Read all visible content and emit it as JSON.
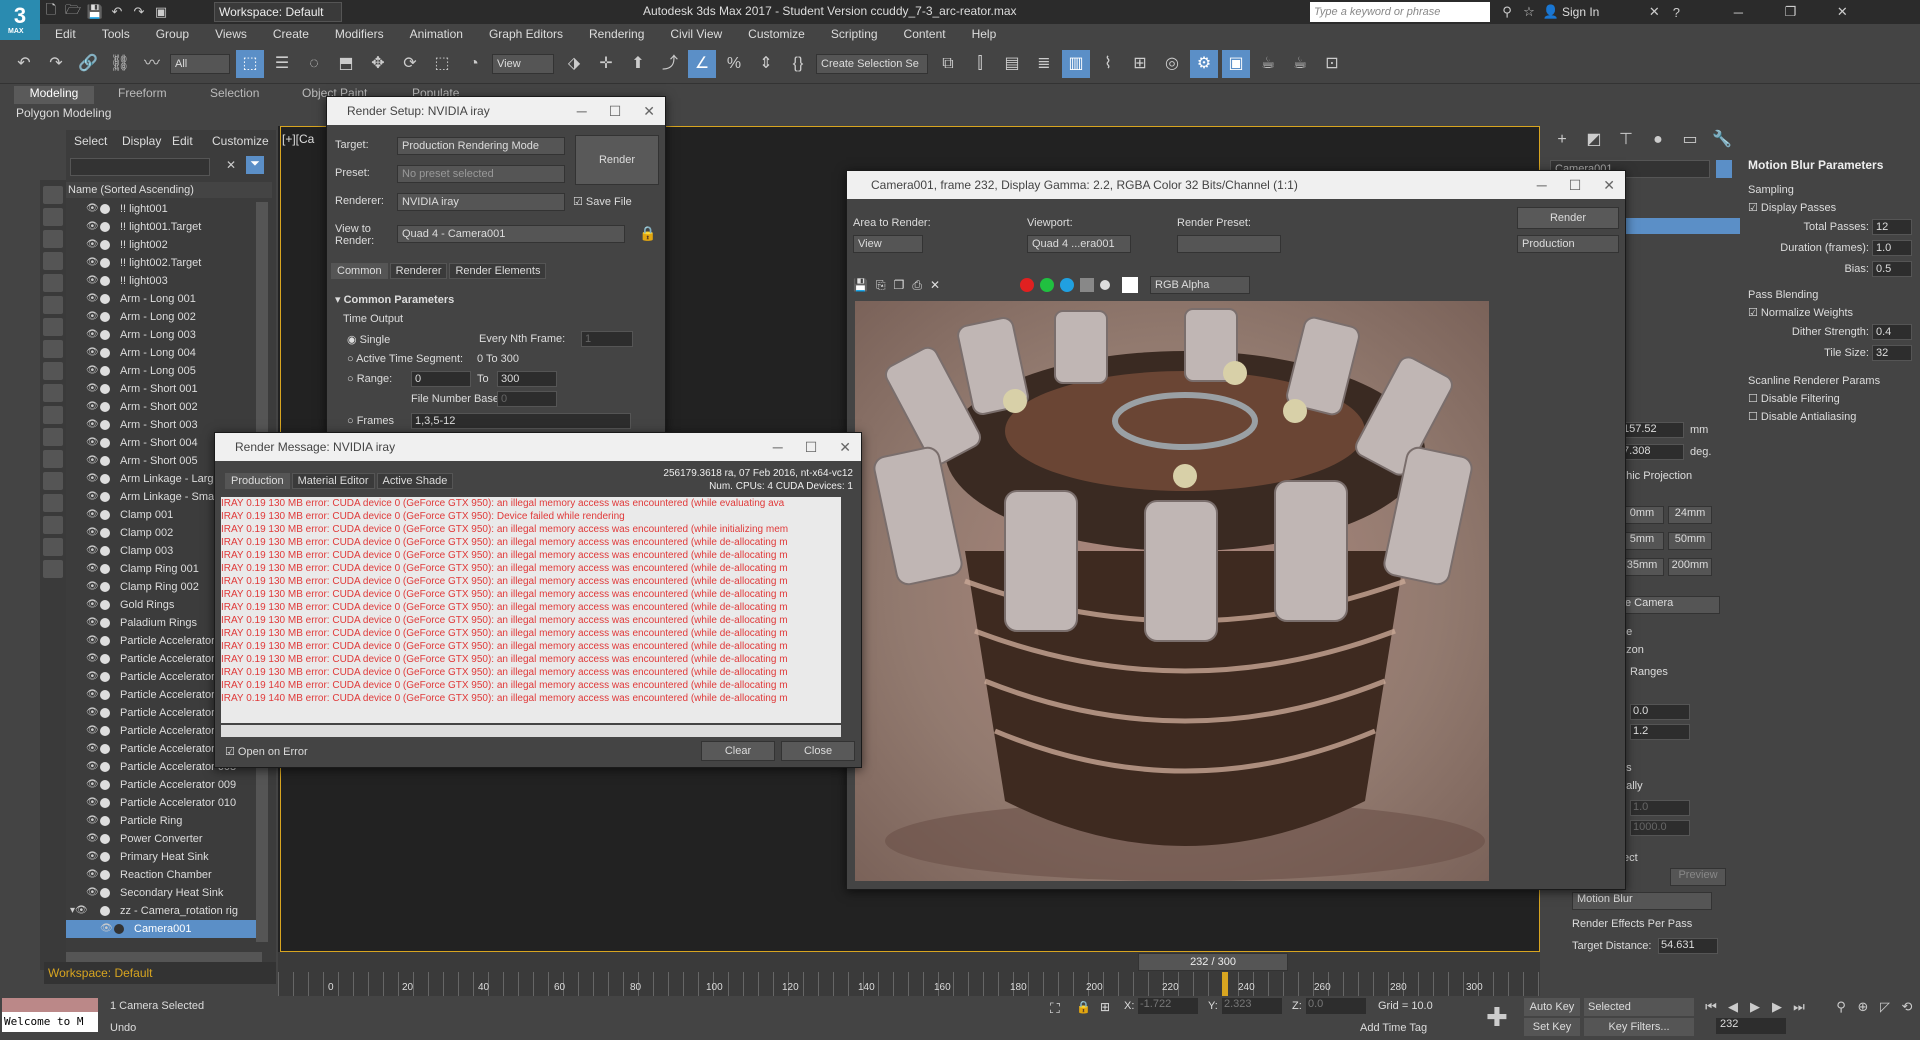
{
  "app": {
    "title": "Autodesk 3ds Max 2017 - Student Version     ccuddy_7-3_arc-reator.max",
    "logo": "3",
    "logo_sub": "MAX",
    "workspace": "Workspace: Default",
    "search_placeholder": "Type a keyword or phrase",
    "sign_in": "Sign In"
  },
  "menu": [
    "Edit",
    "Tools",
    "Group",
    "Views",
    "Create",
    "Modifiers",
    "Animation",
    "Graph Editors",
    "Rendering",
    "Civil View",
    "Customize",
    "Scripting",
    "Content",
    "Help"
  ],
  "toolbar": {
    "filter": "All",
    "view": "View",
    "selection_set": "Create Selection Se"
  },
  "ribbon": {
    "tabs": [
      "Modeling",
      "Freeform",
      "Selection",
      "Object Paint",
      "Populate"
    ],
    "sub": "Polygon Modeling"
  },
  "scene_explorer": {
    "tabs": [
      "Select",
      "Display",
      "Edit",
      "Customize"
    ],
    "header": "Name (Sorted Ascending)",
    "items": [
      "!! light001",
      "!! light001.Target",
      "!! light002",
      "!! light002.Target",
      "!! light003",
      "Arm - Long 001",
      "Arm - Long 002",
      "Arm - Long 003",
      "Arm - Long 004",
      "Arm - Long 005",
      "Arm - Short 001",
      "Arm - Short 002",
      "Arm - Short 003",
      "Arm - Short 004",
      "Arm - Short 005",
      "Arm Linkage - Large",
      "Arm Linkage - Small",
      "Clamp 001",
      "Clamp 002",
      "Clamp 003",
      "Clamp Ring 001",
      "Clamp Ring 002",
      "Gold Rings",
      "Paladium Rings",
      "Particle Accelerator",
      "Particle Accelerator",
      "Particle Accelerator",
      "Particle Accelerator",
      "Particle Accelerator",
      "Particle Accelerator",
      "Particle Accelerator",
      "Particle Accelerator 008",
      "Particle Accelerator 009",
      "Particle Accelerator 010",
      "Particle Ring",
      "Power Converter",
      "Primary Heat Sink",
      "Reaction Chamber",
      "Secondary Heat Sink",
      "zz - Camera_rotation rig",
      "Camera001"
    ],
    "workspace": "Workspace: Default"
  },
  "viewport_label": "[+][Ca",
  "render_setup": {
    "title": "Render Setup: NVIDIA iray",
    "target_label": "Target:",
    "target": "Production Rendering Mode",
    "preset_label": "Preset:",
    "preset": "No preset selected",
    "renderer_label": "Renderer:",
    "renderer": "NVIDIA iray",
    "save_file": "Save File",
    "view_label": "View to Render:",
    "view": "Quad 4 - Camera001",
    "render_btn": "Render",
    "tabs": [
      "Common",
      "Renderer",
      "Render Elements"
    ],
    "section": "Common Parameters",
    "time_output": "Time Output",
    "single": "Single",
    "every_nth": "Every Nth Frame:",
    "every_nth_val": "1",
    "active_seg": "Active Time Segment:",
    "active_seg_val": "0 To 300",
    "range": "Range:",
    "range_from": "0",
    "to": "To",
    "range_to": "300",
    "file_num_base": "File Number Base:",
    "file_num_val": "0",
    "frames": "Frames",
    "frames_val": "1,3,5-12"
  },
  "render_message": {
    "title": "Render Message: NVIDIA iray",
    "tabs": [
      "Production",
      "Material Editor",
      "Active Shade"
    ],
    "info1": "256179.3618 ra, 07 Feb 2016, nt-x64-vc12",
    "info2": "Num. CPUs: 4  CUDA Devices: 1",
    "lines": [
      "IRAY 0.19   130 MB error: CUDA device 0 (GeForce GTX 950): an illegal memory access was encountered (while evaluating ava",
      "IRAY 0.19   130 MB error: CUDA device 0 (GeForce GTX 950): Device failed while rendering",
      "IRAY 0.19   130 MB error: CUDA device 0 (GeForce GTX 950): an illegal memory access was encountered (while initializing mem",
      "IRAY 0.19   130 MB error: CUDA device 0 (GeForce GTX 950): an illegal memory access was encountered (while de-allocating m",
      "IRAY 0.19   130 MB error: CUDA device 0 (GeForce GTX 950): an illegal memory access was encountered (while de-allocating m",
      "IRAY 0.19   130 MB error: CUDA device 0 (GeForce GTX 950): an illegal memory access was encountered (while de-allocating m",
      "IRAY 0.19   130 MB error: CUDA device 0 (GeForce GTX 950): an illegal memory access was encountered (while de-allocating m",
      "IRAY 0.19   130 MB error: CUDA device 0 (GeForce GTX 950): an illegal memory access was encountered (while de-allocating m",
      "IRAY 0.19   130 MB error: CUDA device 0 (GeForce GTX 950): an illegal memory access was encountered (while de-allocating m",
      "IRAY 0.19   130 MB error: CUDA device 0 (GeForce GTX 950): an illegal memory access was encountered (while de-allocating m",
      "IRAY 0.19   130 MB error: CUDA device 0 (GeForce GTX 950): an illegal memory access was encountered (while de-allocating m",
      "IRAY 0.19   130 MB error: CUDA device 0 (GeForce GTX 950): an illegal memory access was encountered (while de-allocating m",
      "IRAY 0.19   130 MB error: CUDA device 0 (GeForce GTX 950): an illegal memory access was encountered (while de-allocating m",
      "IRAY 0.19   130 MB error: CUDA device 0 (GeForce GTX 950): an illegal memory access was encountered (while de-allocating m",
      "IRAY 0.19   140 MB error: CUDA device 0 (GeForce GTX 950): an illegal memory access was encountered (while de-allocating m",
      "IRAY 0.19   140 MB error: CUDA device 0 (GeForce GTX 950): an illegal memory access was encountered (while de-allocating m"
    ],
    "open_on_error": "Open on Error",
    "clear": "Clear",
    "close": "Close"
  },
  "frame_window": {
    "title": "Camera001, frame 232, Display Gamma: 2.2, RGBA Color 32 Bits/Channel (1:1)",
    "area_label": "Area to Render:",
    "area": "View",
    "viewport_label": "Viewport:",
    "viewport": "Quad 4 ...era001",
    "preset_label": "Render Preset:",
    "render_btn": "Render",
    "mode": "Production",
    "channel": "RGB Alpha"
  },
  "motion_blur": {
    "title": "Motion Blur Parameters",
    "sampling": "Sampling",
    "display_passes": "Display Passes",
    "total_passes_label": "Total Passes:",
    "total_passes": "12",
    "duration_label": "Duration (frames):",
    "duration": "1.0",
    "bias_label": "Bias:",
    "bias": "0.5",
    "pass_blending": "Pass Blending",
    "normalize": "Normalize Weights",
    "dither_label": "Dither Strength:",
    "dither": "0.4",
    "tile_label": "Tile Size:",
    "tile": "32",
    "scanline": "Scanline Renderer Params",
    "disable_filtering": "Disable Filtering",
    "disable_aa": "Disable Antialiasing"
  },
  "cmd_panel": {
    "name": "Camera001",
    "lens_label": "157.52",
    "lens_unit": "mm",
    "fov": "7.308",
    "fov_unit": "deg.",
    "ortho": "phic Projection",
    "stock": [
      "0mm",
      "24mm",
      "5mm",
      "50mm",
      "35mm",
      "200mm"
    ],
    "type": "e Camera",
    "ne": "ne",
    "rizon": "rizon",
    "ranges": "Ranges",
    "r1": "0.0",
    "r2": "1.2",
    "es": "es",
    "ually": "ually",
    "c1": "1.0",
    "c2": "1000.0",
    "fect": "fect",
    "preview": "Preview",
    "effect": "Motion Blur",
    "per_pass": "Render Effects Per Pass",
    "target_dist_label": "Target Distance:",
    "target_dist": "54.631"
  },
  "timeline": {
    "frame": "232 / 300",
    "ticks": [
      "0",
      "20",
      "40",
      "60",
      "80",
      "100",
      "120",
      "140",
      "160",
      "180",
      "200",
      "220",
      "240",
      "260",
      "280",
      "300"
    ]
  },
  "status": {
    "welcome": "Welcome to M",
    "selected": "1 Camera Selected",
    "undo": "Undo",
    "x_label": "X:",
    "x": "-1.722",
    "y_label": "Y:",
    "y": "2.323",
    "z_label": "Z:",
    "z": "0.0",
    "grid": "Grid = 10.0",
    "add_time_tag": "Add Time Tag",
    "auto_key": "Auto Key",
    "set_key": "Set Key",
    "selected_mode": "Selected",
    "key_filters": "Key Filters...",
    "frame": "232"
  }
}
